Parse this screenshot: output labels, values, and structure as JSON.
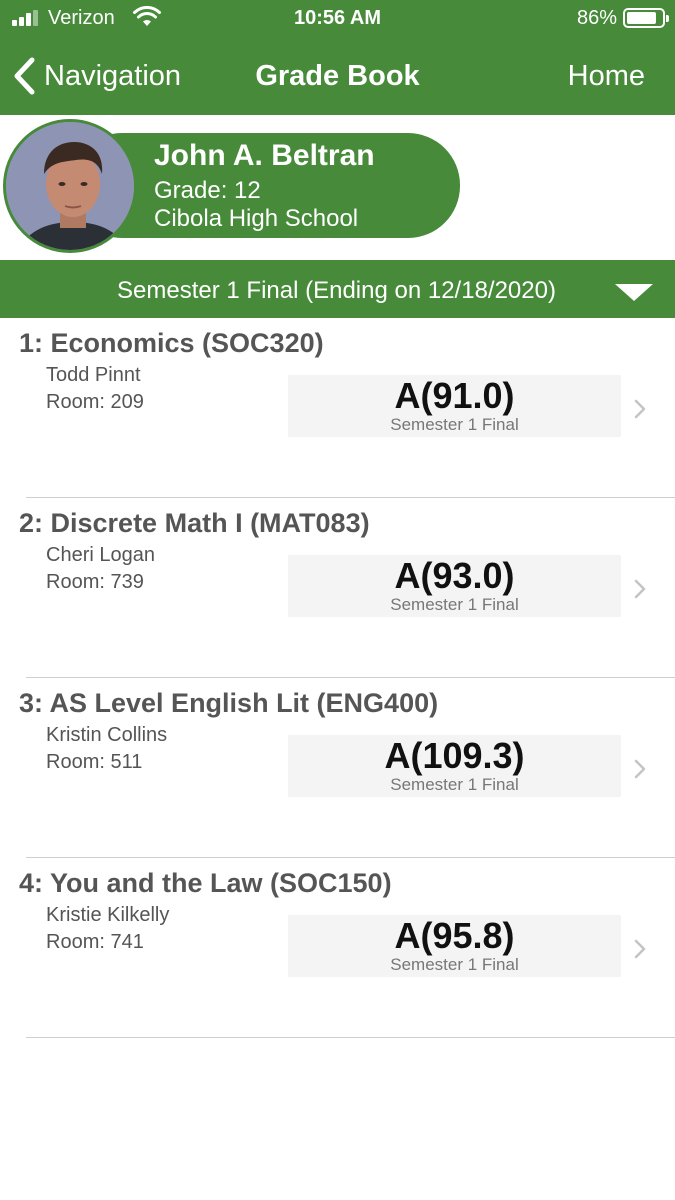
{
  "status_bar": {
    "carrier": "Verizon",
    "time": "10:56 AM",
    "battery": "86%",
    "battery_level": 0.86
  },
  "nav": {
    "back_label": "Navigation",
    "title": "Grade Book",
    "home_label": "Home"
  },
  "student": {
    "name": "John A. Beltran",
    "grade": "Grade: 12",
    "school": "Cibola High School"
  },
  "term": {
    "label": "Semester 1 Final (Ending on 12/18/2020)"
  },
  "courses": [
    {
      "title": "1: Economics (SOC320)",
      "teacher": "Todd Pinnt",
      "room": "Room: 209",
      "grade": "A(91.0)",
      "term": "Semester 1 Final"
    },
    {
      "title": "2: Discrete Math I (MAT083)",
      "teacher": "Cheri Logan",
      "room": "Room: 739",
      "grade": "A(93.0)",
      "term": "Semester 1 Final"
    },
    {
      "title": "3: AS Level English Lit (ENG400)",
      "teacher": "Kristin Collins",
      "room": "Room: 511",
      "grade": "A(109.3)",
      "term": "Semester 1 Final"
    },
    {
      "title": "4: You and the Law (SOC150)",
      "teacher": "Kristie Kilkelly",
      "room": "Room: 741",
      "grade": "A(95.8)",
      "term": "Semester 1 Final"
    }
  ],
  "colors": {
    "brand_green": "#468a3a",
    "grade_box": "#f4f4f4"
  },
  "icons": [
    "signal-icon",
    "wifi-icon",
    "battery-icon",
    "back-chevron-icon",
    "dropdown-caret-icon",
    "row-chevron-icon",
    "avatar"
  ]
}
